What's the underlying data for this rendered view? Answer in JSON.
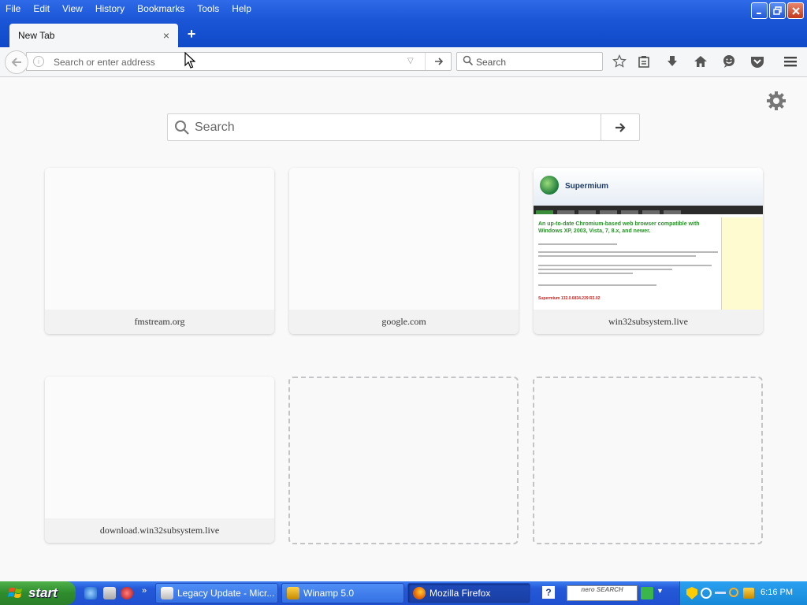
{
  "menubar": {
    "items": [
      "File",
      "Edit",
      "View",
      "History",
      "Bookmarks",
      "Tools",
      "Help"
    ]
  },
  "tabs": [
    {
      "label": "New Tab",
      "active": true
    }
  ],
  "navbar": {
    "url_placeholder": "Search or enter address",
    "url_value": "",
    "search_placeholder": "Search"
  },
  "newtab": {
    "search_placeholder": "Search",
    "tiles": [
      {
        "title": "fmstream.org",
        "thumbnail": "blank"
      },
      {
        "title": "google.com",
        "thumbnail": "blank"
      },
      {
        "title": "win32subsystem.live",
        "thumbnail": "supermium-page"
      },
      {
        "title": "download.win32subsystem.live",
        "thumbnail": "blank"
      },
      {
        "title": "",
        "thumbnail": "empty-slot"
      },
      {
        "title": "",
        "thumbnail": "empty-slot"
      }
    ],
    "supermium_preview": {
      "site_name": "Supermium",
      "headline": "An up-to-date Chromium-based web browser compatible with Windows XP, 2003, Vista, 7, 8.x, and newer.",
      "version_line": "Supermium 132.0.6834.229 R3.02"
    }
  },
  "taskbar": {
    "start_label": "start",
    "buttons": [
      {
        "label": "Legacy Update - Micr...",
        "icon": "legacy-update-icon",
        "active": false
      },
      {
        "label": "Winamp 5.0",
        "icon": "winamp-icon",
        "active": false
      },
      {
        "label": "Mozilla Firefox",
        "icon": "firefox-icon",
        "active": true
      }
    ],
    "nero_label": "nero SEARCH",
    "clock": "6:16 PM"
  },
  "colors": {
    "titlebar": "#1a56d6",
    "taskbar": "#2459d8",
    "start_button": "#2e8c2c",
    "page_background": "#f9f9fa",
    "supermium_headline": "#2d8d2d"
  }
}
